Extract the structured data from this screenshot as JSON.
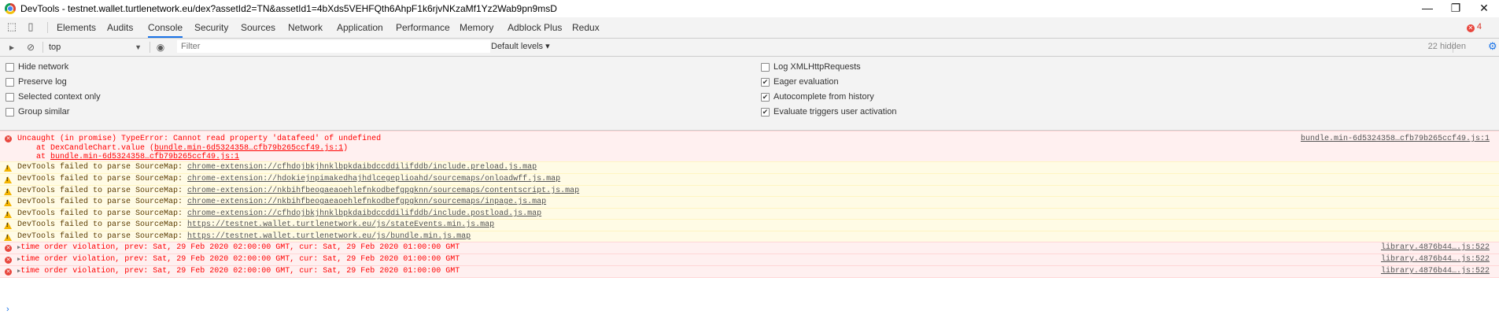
{
  "window": {
    "title": "DevTools - testnet.wallet.turtlenetwork.eu/dex?assetId2=TN&assetId1=4bXds5VEHFQth6AhpF1k6rjvNKzaMf1Yz2Wab9pn9msD",
    "minimize": "—",
    "restore": "❐",
    "close": "✕"
  },
  "tabs": [
    "Elements",
    "Audits",
    "Console",
    "Security",
    "Sources",
    "Network",
    "Application",
    "Performance",
    "Memory",
    "Adblock Plus",
    "Redux"
  ],
  "active_tab": "Console",
  "error_count": "4",
  "toolbar": {
    "context": "top",
    "filter_placeholder": "Filter",
    "levels": "Default levels ▾",
    "hidden": "22 hidden"
  },
  "settings": {
    "left": [
      {
        "label": "Hide network",
        "checked": false
      },
      {
        "label": "Preserve log",
        "checked": false
      },
      {
        "label": "Selected context only",
        "checked": false
      },
      {
        "label": "Group similar",
        "checked": false
      }
    ],
    "right": [
      {
        "label": "Log XMLHttpRequests",
        "checked": false
      },
      {
        "label": "Eager evaluation",
        "checked": true
      },
      {
        "label": "Autocomplete from history",
        "checked": true
      },
      {
        "label": "Evaluate triggers user activation",
        "checked": true
      }
    ]
  },
  "messages": {
    "uncaught": {
      "line1": "Uncaught (in promise) TypeError: Cannot read property 'datafeed' of undefined",
      "line2_prefix": "    at DexCandleChart.value (",
      "line2_link": "bundle.min-6d5324358…cfb79b265ccf49.js:1",
      "line2_suffix": ")",
      "line3_prefix": "    at ",
      "line3_link": "bundle.min-6d5324358…cfb79b265ccf49.js:1",
      "source": "bundle.min-6d5324358…cfb79b265ccf49.js:1"
    },
    "warn_prefix": "DevTools failed to parse SourceMap: ",
    "warnings": [
      "chrome-extension://cfhdojbkjhnklbpkdaibdccddilifddb/include.preload.js.map",
      "chrome-extension://hdokiejnpimakedhajhdlcegeplioahd/sourcemaps/onloadwff.js.map",
      "chrome-extension://nkbihfbeogaeaoehlefnkodbefgpgknn/sourcemaps/contentscript.js.map",
      "chrome-extension://nkbihfbeogaeaoehlefnkodbefgpgknn/sourcemaps/inpage.js.map",
      "chrome-extension://cfhdojbkjhnklbpkdaibdccddilifddb/include.postload.js.map",
      "https://testnet.wallet.turtlenetwork.eu/js/stateEvents.min.js.map",
      "https://testnet.wallet.turtlenetwork.eu/js/bundle.min.js.map"
    ],
    "violations": [
      {
        "text": "time order violation, prev: Sat, 29 Feb 2020 02:00:00 GMT, cur: Sat, 29 Feb 2020 01:00:00 GMT",
        "source": "library.4876b44….js:522"
      },
      {
        "text": "time order violation, prev: Sat, 29 Feb 2020 02:00:00 GMT, cur: Sat, 29 Feb 2020 01:00:00 GMT",
        "source": "library.4876b44….js:522"
      },
      {
        "text": "time order violation, prev: Sat, 29 Feb 2020 02:00:00 GMT, cur: Sat, 29 Feb 2020 01:00:00 GMT",
        "source": "library.4876b44….js:522"
      }
    ]
  },
  "icons": {
    "inspect": "inspect-element-icon",
    "device": "device-toolbar-icon",
    "sidebar": "show-sidebar-icon",
    "clear": "clear-console-icon",
    "eye": "live-expression-icon",
    "gear": "settings-gear-icon"
  },
  "colors": {
    "error_bg": "#fff0f0",
    "error_text": "#ff0000",
    "warn_bg": "#fffbe5",
    "accent": "#1a73e8"
  }
}
